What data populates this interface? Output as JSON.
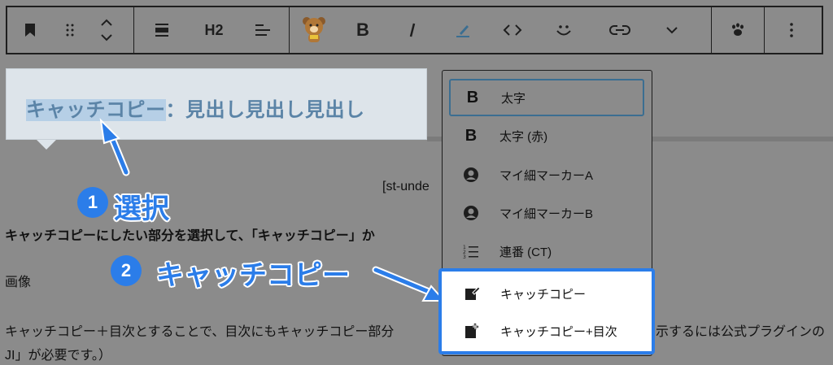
{
  "toolbar": {
    "heading_level": "H2",
    "buttons": [
      "bookmark-icon",
      "drag-handle-icon",
      "move-up-down-icon",
      "align-icon",
      "H2",
      "text-align-icon",
      "bear-icon",
      "bold-icon",
      "italic-icon",
      "highlight-pen-icon",
      "code-icon",
      "smile-icon",
      "link-icon",
      "chevron-down-icon",
      "paw-icon",
      "more-options-icon"
    ]
  },
  "heading": {
    "selected": "キャッチコピー",
    "rest": "：見出し見出し見出し"
  },
  "body": {
    "shortcode": "[st-unde",
    "line1": "キャッチコピーにしたい部分を選択して、「キャッチコピー」か",
    "line2": "画像",
    "line3_left": "キャッチコピー＋目次とすることで、目次にもキャッチコピー部分",
    "line3_right": "示するには公式プラグインの",
    "line4": "JI」が必要です。）"
  },
  "annotations": {
    "step1_number": "1",
    "step1_label": "選択",
    "step2_number": "2",
    "step2_label": "キャッチコピー"
  },
  "dropdown": {
    "items": [
      {
        "icon": "bold-icon",
        "label": "太字"
      },
      {
        "icon": "bold-icon",
        "label": "太字 (赤)"
      },
      {
        "icon": "person-circle-icon",
        "label": "マイ細マーカーA"
      },
      {
        "icon": "person-circle-icon",
        "label": "マイ細マーカーB"
      },
      {
        "icon": "numbered-list-icon",
        "label": "連番 (CT)"
      },
      {
        "icon": "edit-note-icon",
        "label": "キャッチコピー"
      },
      {
        "icon": "note-add-icon",
        "label": "キャッチコピー+目次"
      }
    ]
  },
  "colors": {
    "accent": "#2b7de9",
    "heading_text": "#5b84a7",
    "selection": "#b6cfe6",
    "overlay": "#8b8b8b"
  }
}
